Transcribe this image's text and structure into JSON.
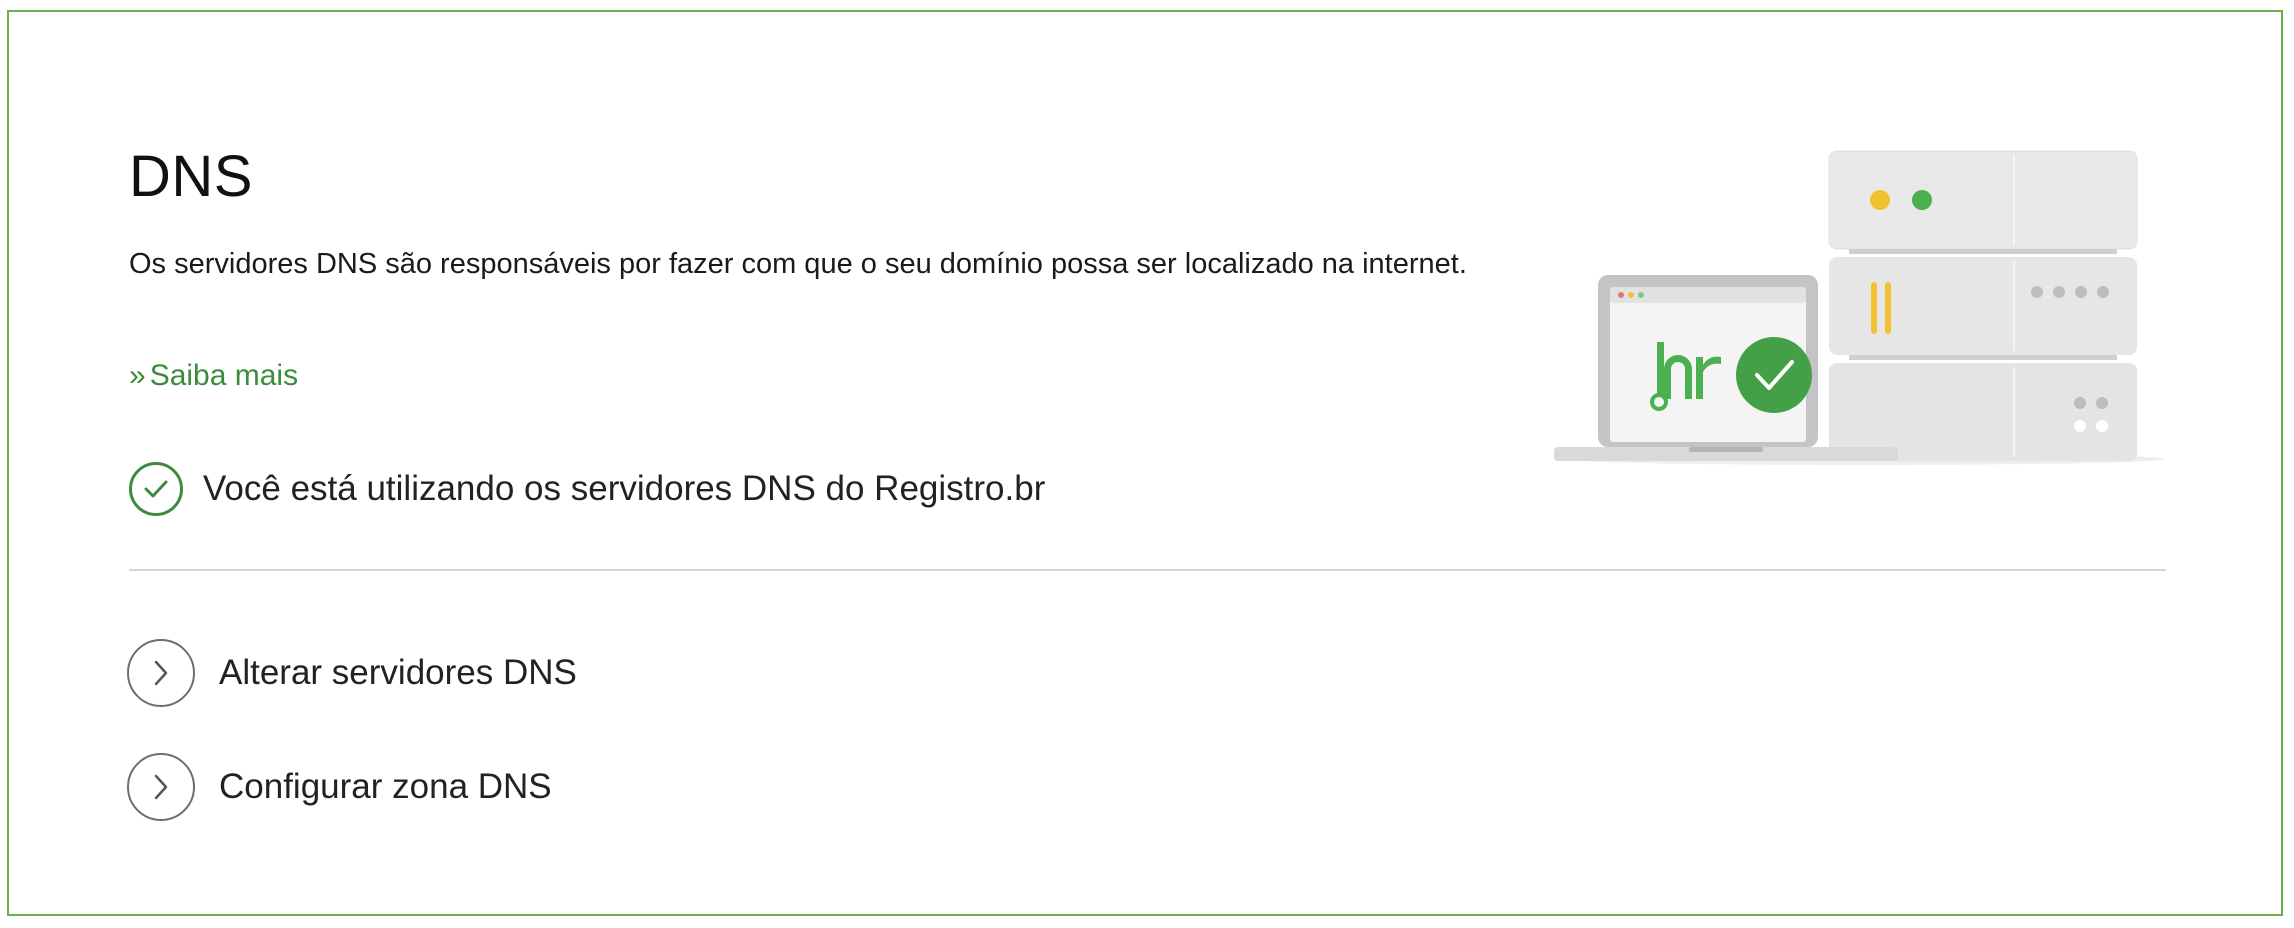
{
  "section": {
    "title": "DNS",
    "description": "Os servidores DNS são responsáveis por fazer com que o seu domínio possa ser localizado na internet.",
    "learn_more": {
      "prefix": "»",
      "label": "Saiba mais"
    },
    "status": {
      "icon": "check-circle-icon",
      "text": "Você está utilizando os servidores DNS do Registro.br"
    }
  },
  "actions": [
    {
      "icon": "chevron-right-icon",
      "label": "Alterar servidores DNS"
    },
    {
      "icon": "chevron-right-icon",
      "label": "Configurar zona DNS"
    }
  ],
  "illustration": {
    "name": "dns-servers-illustration",
    "logo_text": ".br"
  },
  "colors": {
    "border": "#6ab04c",
    "accent_green": "#3d8b3d",
    "logo_green": "#4caf50",
    "led_yellow": "#f2c232",
    "led_green": "#4caf50",
    "divider": "#d6d6d6"
  }
}
